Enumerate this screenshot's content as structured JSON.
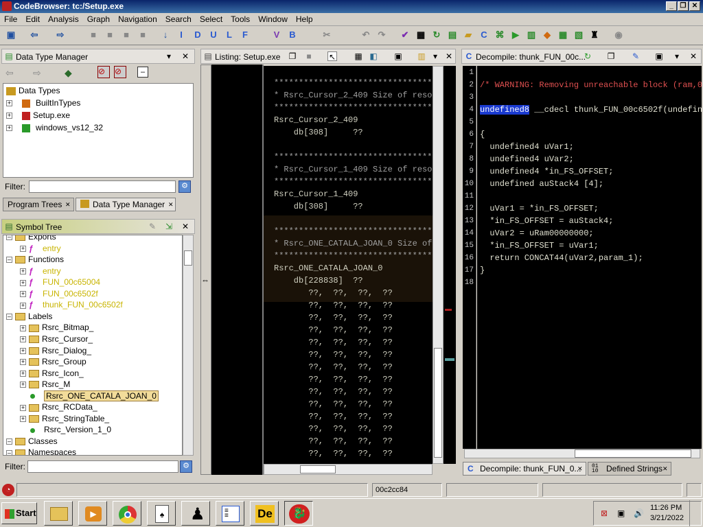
{
  "window": {
    "title": "CodeBrowser: tc:/Setup.exe"
  },
  "menu": [
    "File",
    "Edit",
    "Analysis",
    "Graph",
    "Navigation",
    "Search",
    "Select",
    "Tools",
    "Window",
    "Help"
  ],
  "toolbar_icons": [
    "save-icon",
    "back-icon",
    "forward-icon",
    "I",
    "D",
    "U",
    "L",
    "F",
    "V",
    "B"
  ],
  "dtm": {
    "title": "Data Type Manager",
    "root": "Data Types",
    "items": [
      "BuiltInTypes",
      "Setup.exe",
      "windows_vs12_32"
    ],
    "filter_label": "Filter:"
  },
  "lefttabs": {
    "tab1": "Program Trees",
    "tab2": "Data Type Manager"
  },
  "symtree": {
    "title": "Symbol Tree",
    "rows": [
      {
        "label": "Exports",
        "level": 1,
        "kind": "folder",
        "color": "#000"
      },
      {
        "label": "entry",
        "level": 2,
        "kind": "func",
        "color": "#c8b400"
      },
      {
        "label": "Functions",
        "level": 1,
        "kind": "folder",
        "color": "#000"
      },
      {
        "label": "entry",
        "level": 2,
        "kind": "func",
        "color": "#c8b400"
      },
      {
        "label": "FUN_00c65004",
        "level": 2,
        "kind": "func",
        "color": "#c8b400"
      },
      {
        "label": "FUN_00c6502f",
        "level": 2,
        "kind": "func",
        "color": "#c8b400"
      },
      {
        "label": "thunk_FUN_00c6502f",
        "level": 2,
        "kind": "func",
        "color": "#c8b400"
      },
      {
        "label": "Labels",
        "level": 1,
        "kind": "folder",
        "color": "#000"
      },
      {
        "label": "Rsrc_Bitmap_",
        "level": 2,
        "kind": "folder",
        "color": "#000"
      },
      {
        "label": "Rsrc_Cursor_",
        "level": 2,
        "kind": "folder",
        "color": "#000"
      },
      {
        "label": "Rsrc_Dialog_",
        "level": 2,
        "kind": "folder",
        "color": "#000"
      },
      {
        "label": "Rsrc_Group",
        "level": 2,
        "kind": "folder",
        "color": "#000"
      },
      {
        "label": "Rsrc_Icon_",
        "level": 2,
        "kind": "folder",
        "color": "#000"
      },
      {
        "label": "Rsrc_M",
        "level": 2,
        "kind": "folder",
        "color": "#000"
      },
      {
        "label": "Rsrc_ONE_CATALA_JOAN_0",
        "level": 2,
        "kind": "label",
        "color": "#000",
        "selected": true
      },
      {
        "label": "Rsrc_RCData_",
        "level": 2,
        "kind": "folder",
        "color": "#000"
      },
      {
        "label": "Rsrc_StringTable_",
        "level": 2,
        "kind": "folder",
        "color": "#000"
      },
      {
        "label": "Rsrc_Version_1_0",
        "level": 2,
        "kind": "label",
        "color": "#000"
      },
      {
        "label": "Classes",
        "level": 1,
        "kind": "folder",
        "color": "#000"
      },
      {
        "label": "Namespaces",
        "level": 1,
        "kind": "folder",
        "color": "#000"
      }
    ],
    "filter_label": "Filter:"
  },
  "listing": {
    "title": "Listing:  Setup.exe",
    "lines": [
      "******************************************",
      "* Rsrc_Cursor_2_409 Size of resou",
      "******************************************",
      "Rsrc_Cursor_2_409",
      "    db[308]     ??",
      "",
      "******************************************",
      "* Rsrc_Cursor_1_409 Size of resou",
      "******************************************",
      "Rsrc_Cursor_1_409",
      "    db[308]     ??",
      "",
      "******************************************",
      "* Rsrc_ONE_CATALA_JOAN_0 Size of",
      "******************************************",
      "Rsrc_ONE_CATALA_JOAN_0",
      "    db[228838]  ??",
      "       ??,  ??,  ??,  ??",
      "       ??,  ??,  ??,  ??",
      "       ??,  ??,  ??,  ??",
      "       ??,  ??,  ??,  ??",
      "       ??,  ??,  ??,  ??",
      "       ??,  ??,  ??,  ??",
      "       ??,  ??,  ??,  ??",
      "       ??,  ??,  ??,  ??",
      "       ??,  ??,  ??,  ??",
      "       ??,  ??,  ??,  ??",
      "       ??,  ??,  ??,  ??",
      "       ??,  ??,  ??,  ??",
      "       ??,  ??,  ??,  ??",
      "       ??,  ??,  ??,  ??"
    ]
  },
  "decompile": {
    "title": "Decompile: thunk_FUN_00c...",
    "lines": [
      "",
      "/* WARNING: Removing unreachable block (ram,0x",
      "",
      "undefined8 __cdecl thunk_FUN_00c6502f(undefine",
      "",
      "{",
      "  undefined4 uVar1;",
      "  undefined4 uVar2;",
      "  undefined4 *in_FS_OFFSET;",
      "  undefined auStack4 [4];",
      "",
      "  uVar1 = *in_FS_OFFSET;",
      "  *in_FS_OFFSET = auStack4;",
      "  uVar2 = uRam00000000;",
      "  *in_FS_OFFSET = uVar1;",
      "  return CONCAT44(uVar2,param_1);",
      "}",
      ""
    ]
  },
  "righttabs": {
    "tab1": "Decompile: thunk_FUN_0...",
    "tab2": "Defined Strings"
  },
  "status": {
    "address": "00c2cc84"
  },
  "taskbar": {
    "start": "Start",
    "time": "11:26 PM",
    "date": "3/21/2022"
  }
}
